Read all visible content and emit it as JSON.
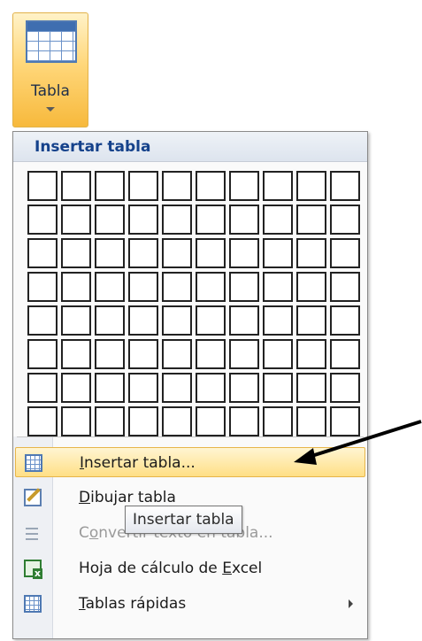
{
  "ribbon": {
    "table_button_label": "Tabla"
  },
  "menu": {
    "header": "Insertar tabla",
    "grid": {
      "columns": 10,
      "rows": 8
    },
    "items": [
      {
        "pre": "",
        "u": "I",
        "post": "nsertar tabla...",
        "disabled": false,
        "icon": "table-icon"
      },
      {
        "pre": "",
        "u": "D",
        "post": "ibujar tabla",
        "disabled": false,
        "icon": "pencil-icon"
      },
      {
        "pre": "C",
        "u": "o",
        "post": "nvertir texto en tabla...",
        "disabled": true,
        "icon": "convert-text-icon"
      },
      {
        "pre": "Hoja de cálculo de ",
        "u": "E",
        "post": "xcel",
        "disabled": false,
        "icon": "excel-icon"
      },
      {
        "pre": "",
        "u": "T",
        "post": "ablas rápidas",
        "disabled": false,
        "icon": "quick-tables-icon"
      }
    ]
  },
  "tooltip": {
    "text": "Insertar tabla"
  }
}
